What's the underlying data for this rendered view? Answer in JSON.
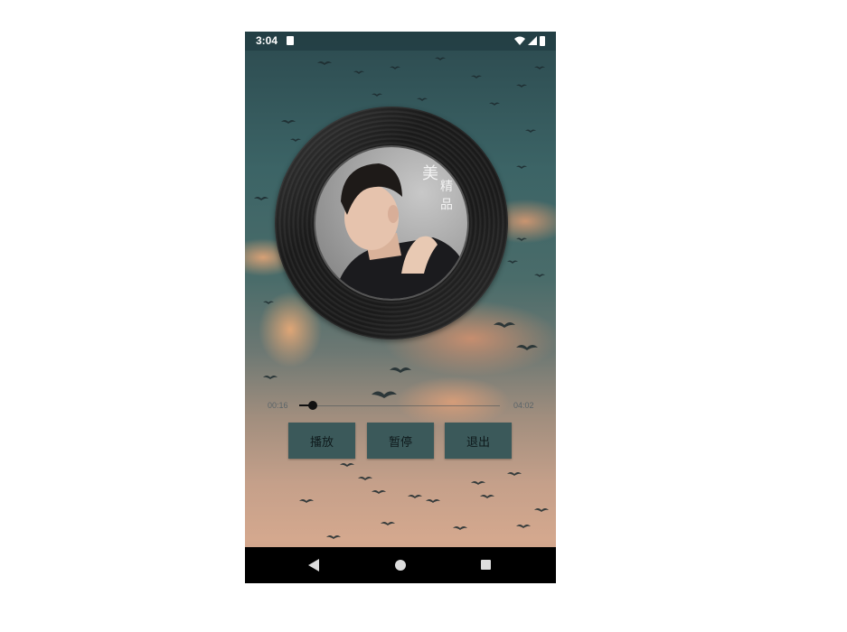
{
  "status_bar": {
    "time": "3:04",
    "icons": [
      "sd-card-icon",
      "wifi-icon",
      "signal-icon",
      "battery-icon"
    ]
  },
  "album": {
    "cover_icon": "album-cover-portrait",
    "cover_text": "美人 精品"
  },
  "player": {
    "current_time": "00:16",
    "duration": "04:02",
    "progress": 0.066
  },
  "buttons": {
    "play": "播放",
    "pause": "暂停",
    "exit": "退出"
  },
  "nav_bar": {
    "icons": [
      "back-icon",
      "home-icon",
      "recent-apps-icon"
    ]
  },
  "colors": {
    "button_bg": "#3b595a",
    "nav_bg": "#000000"
  }
}
